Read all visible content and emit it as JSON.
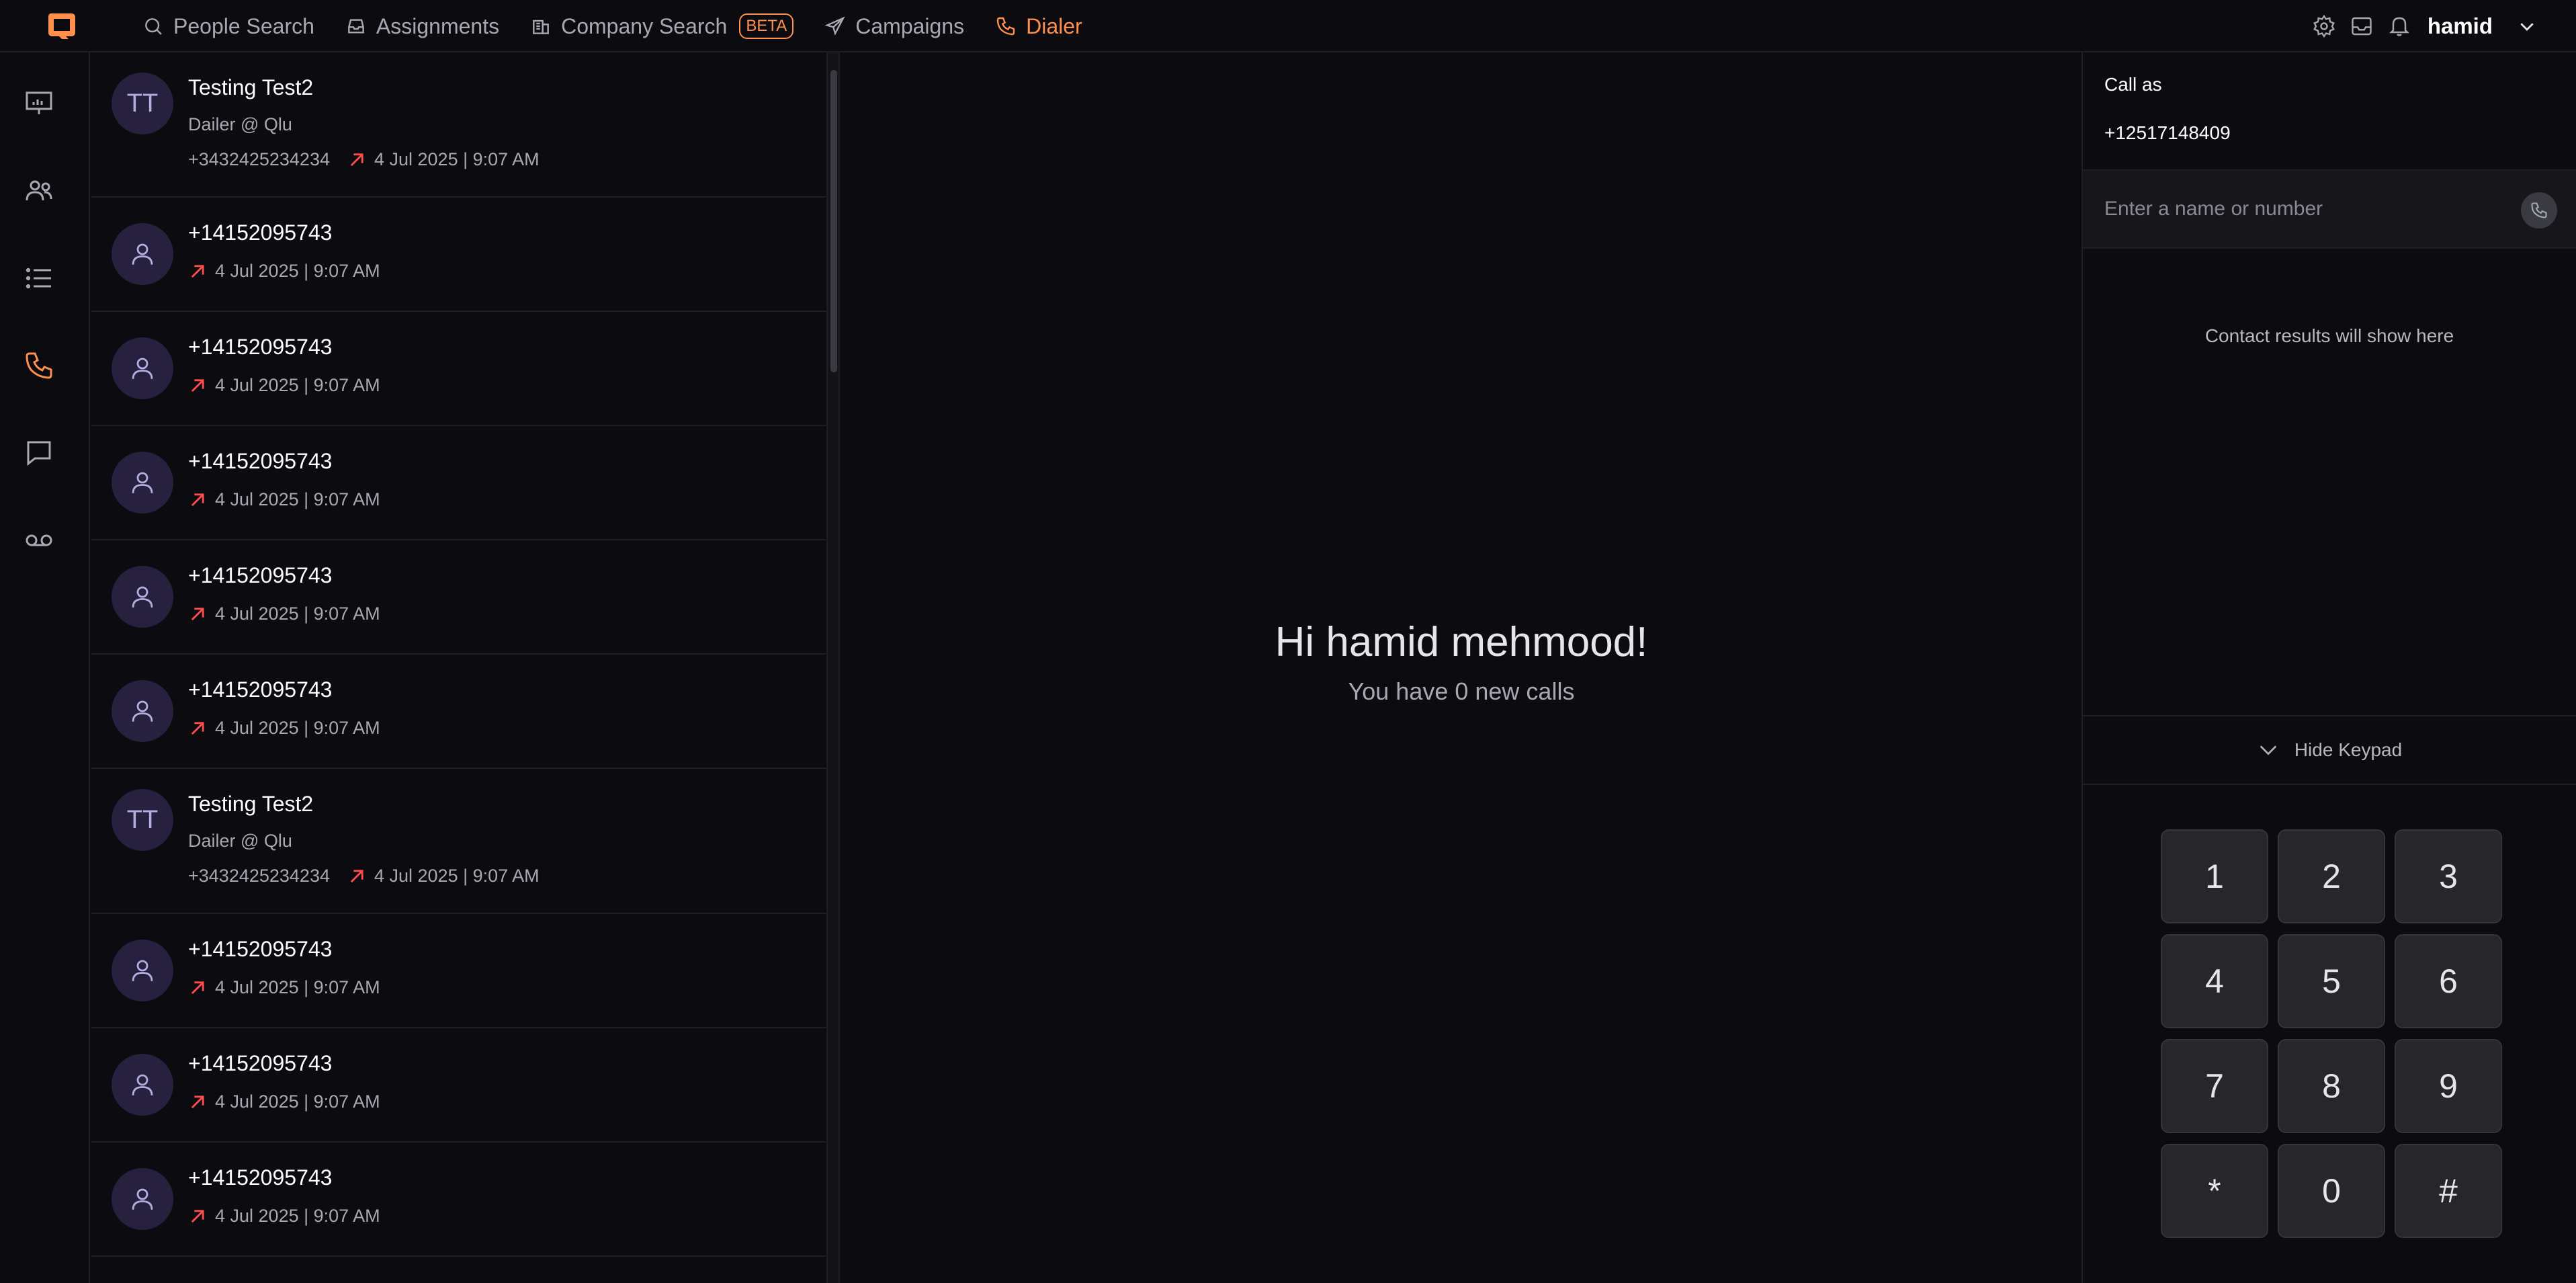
{
  "nav": {
    "items": [
      {
        "label": "People Search",
        "icon": "search-icon"
      },
      {
        "label": "Assignments",
        "icon": "inbox-icon"
      },
      {
        "label": "Company Search",
        "icon": "building-icon",
        "badge": "BETA"
      },
      {
        "label": "Campaigns",
        "icon": "send-icon"
      },
      {
        "label": "Dialer",
        "icon": "phone-icon",
        "active": true
      }
    ],
    "user": "hamid"
  },
  "colors": {
    "accent": "#ff8f4d",
    "outgoing_arrow": "#ff4d4d",
    "avatar_bg": "#27213f",
    "background": "#0c0c10"
  },
  "rail": [
    "presentation-icon",
    "users-icon",
    "list-icon",
    "phone-icon",
    "message-icon",
    "voicemail-icon"
  ],
  "calls": [
    {
      "name": "Testing Test2",
      "initials": "TT",
      "subtitle": "Dailer @ Qlu",
      "phone": "+3432425234234",
      "time": "4 Jul 2025 | 9:07 AM"
    },
    {
      "name": "+14152095743",
      "time": "4 Jul 2025 | 9:07 AM"
    },
    {
      "name": "+14152095743",
      "time": "4 Jul 2025 | 9:07 AM"
    },
    {
      "name": "+14152095743",
      "time": "4 Jul 2025 | 9:07 AM"
    },
    {
      "name": "+14152095743",
      "time": "4 Jul 2025 | 9:07 AM"
    },
    {
      "name": "+14152095743",
      "time": "4 Jul 2025 | 9:07 AM"
    },
    {
      "name": "Testing Test2",
      "initials": "TT",
      "subtitle": "Dailer @ Qlu",
      "phone": "+3432425234234",
      "time": "4 Jul 2025 | 9:07 AM"
    },
    {
      "name": "+14152095743",
      "time": "4 Jul 2025 | 9:07 AM"
    },
    {
      "name": "+14152095743",
      "time": "4 Jul 2025 | 9:07 AM"
    },
    {
      "name": "+14152095743",
      "time": "4 Jul 2025 | 9:07 AM"
    }
  ],
  "center": {
    "greeting": "Hi hamid mehmood!",
    "subtitle": "You have 0 new calls"
  },
  "dialer": {
    "call_as_label": "Call as",
    "call_as_number": "+12517148409",
    "search_placeholder": "Enter a name or number",
    "results_placeholder": "Contact results will show here",
    "toggle_label": "Hide Keypad",
    "keys": [
      "1",
      "2",
      "3",
      "4",
      "5",
      "6",
      "7",
      "8",
      "9",
      "*",
      "0",
      "#"
    ]
  }
}
